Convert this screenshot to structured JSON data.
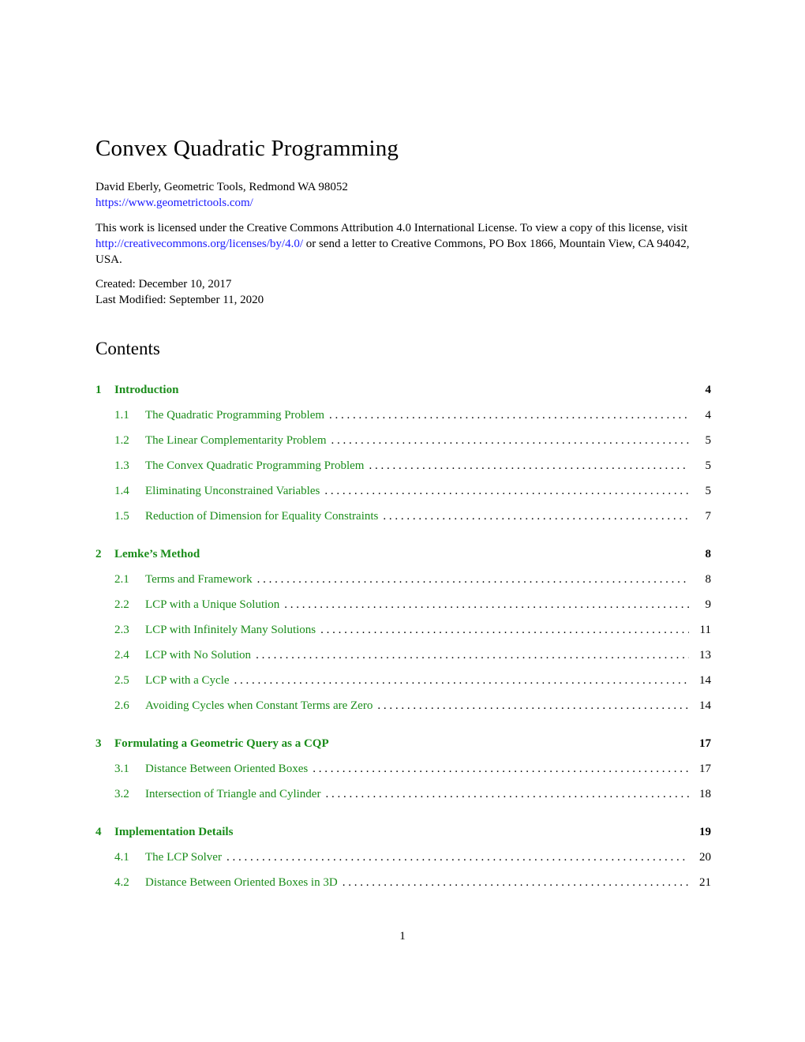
{
  "document": {
    "title": "Convex Quadratic Programming",
    "author_line": "David Eberly, Geometric Tools, Redmond WA 98052",
    "author_url": "https://www.geometrictools.com/",
    "license": {
      "text_before_link": "This work is licensed under the Creative Commons Attribution 4.0 International License. To view a copy of this license, visit ",
      "link": "http://creativecommons.org/licenses/by/4.0/",
      "text_after_link": " or send a letter to Creative Commons, PO Box 1866, Mountain View, CA 94042, USA."
    },
    "created": "Created: December 10, 2017",
    "last_modified": "Last Modified: September 11, 2020",
    "contents_heading": "Contents",
    "page_number": "1"
  },
  "colors": {
    "link_blue": "#1a1aff",
    "toc_green": "#1a8c1a"
  },
  "toc": [
    {
      "type": "section",
      "num": "1",
      "label": "Introduction",
      "page": "4"
    },
    {
      "type": "sub",
      "num": "1.1",
      "label": "The Quadratic Programming Problem",
      "page": "4"
    },
    {
      "type": "sub",
      "num": "1.2",
      "label": "The Linear Complementarity Problem",
      "page": "5"
    },
    {
      "type": "sub",
      "num": "1.3",
      "label": "The Convex Quadratic Programming Problem",
      "page": "5"
    },
    {
      "type": "sub",
      "num": "1.4",
      "label": "Eliminating Unconstrained Variables",
      "page": "5"
    },
    {
      "type": "sub",
      "num": "1.5",
      "label": "Reduction of Dimension for Equality Constraints",
      "page": "7"
    },
    {
      "type": "section",
      "num": "2",
      "label": "Lemke’s Method",
      "page": "8"
    },
    {
      "type": "sub",
      "num": "2.1",
      "label": "Terms and Framework",
      "page": "8"
    },
    {
      "type": "sub",
      "num": "2.2",
      "label": "LCP with a Unique Solution",
      "page": "9"
    },
    {
      "type": "sub",
      "num": "2.3",
      "label": "LCP with Infinitely Many Solutions",
      "page": "11"
    },
    {
      "type": "sub",
      "num": "2.4",
      "label": "LCP with No Solution",
      "page": "13"
    },
    {
      "type": "sub",
      "num": "2.5",
      "label": "LCP with a Cycle",
      "page": "14"
    },
    {
      "type": "sub",
      "num": "2.6",
      "label": "Avoiding Cycles when Constant Terms are Zero",
      "page": "14"
    },
    {
      "type": "section",
      "num": "3",
      "label": "Formulating a Geometric Query as a CQP",
      "page": "17"
    },
    {
      "type": "sub",
      "num": "3.1",
      "label": "Distance Between Oriented Boxes",
      "page": "17"
    },
    {
      "type": "sub",
      "num": "3.2",
      "label": "Intersection of Triangle and Cylinder",
      "page": "18"
    },
    {
      "type": "section",
      "num": "4",
      "label": "Implementation Details",
      "page": "19"
    },
    {
      "type": "sub",
      "num": "4.1",
      "label": "The LCP Solver",
      "page": "20"
    },
    {
      "type": "sub",
      "num": "4.2",
      "label": "Distance Between Oriented Boxes in 3D",
      "page": "21"
    }
  ]
}
